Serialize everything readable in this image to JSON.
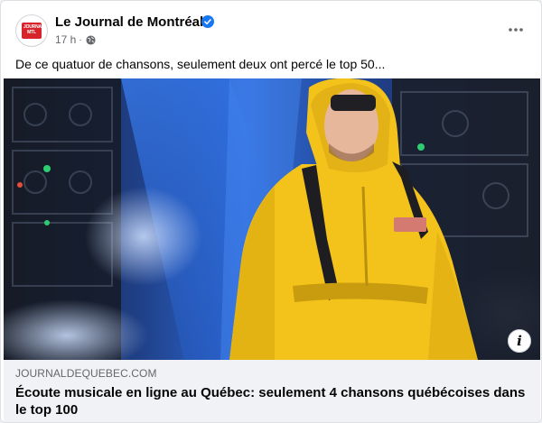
{
  "post": {
    "page_name": "Le Journal de Montréal",
    "timestamp": "17 h",
    "separator": "·",
    "caption": "De ce quatuor de chansons, seulement deux ont percé le top 50...",
    "icons": {
      "avatar": "journal-de-montreal-logo",
      "verified": "verified-badge-icon",
      "audience": "globe-icon",
      "more": "more-options-icon",
      "info": "info-icon"
    },
    "colors": {
      "brand_red": "#d6242a",
      "verified_blue": "#1877f2",
      "secondary_text": "#65676b",
      "hoodie_yellow": "#f3c21b"
    }
  },
  "link_preview": {
    "domain": "JOURNALDEQUEBEC.COM",
    "headline": "Écoute musicale en ligne au Québec: seulement 4 chansons québécoises dans le top 100"
  }
}
